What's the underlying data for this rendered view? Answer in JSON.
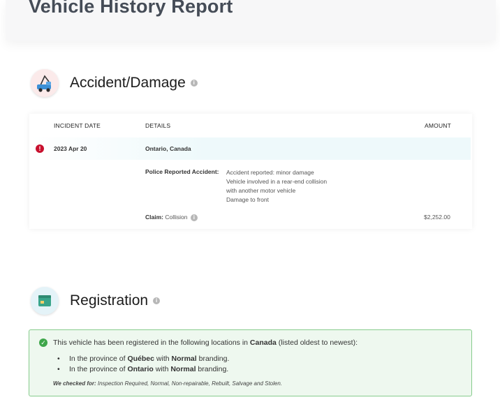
{
  "page": {
    "title": "Vehicle History Report"
  },
  "accident": {
    "title": "Accident/Damage",
    "columns": {
      "date": "INCIDENT DATE",
      "details": "DETAILS",
      "amount": "AMOUNT"
    },
    "record": {
      "date": "2023 Apr 20",
      "location": "Ontario, Canada",
      "police_label": "Police Reported Accident:",
      "police_lines": [
        "Accident reported: minor damage",
        "Vehicle involved in a rear-end collision",
        "with another motor vehicle",
        "Damage to front"
      ],
      "claim_label": "Claim:",
      "claim_value": "Collision",
      "amount": "$2,252.00"
    }
  },
  "registration": {
    "title": "Registration",
    "intro_pre": "This vehicle has been registered in the following locations in ",
    "intro_country": "Canada",
    "intro_post": " (listed oldest to newest):",
    "items": [
      {
        "pre": "In the province of ",
        "province": "Québec",
        "mid": " with ",
        "branding": "Normal",
        "post": " branding."
      },
      {
        "pre": "In the province of ",
        "province": "Ontario",
        "mid": " with ",
        "branding": "Normal",
        "post": " branding."
      }
    ],
    "checked_label": "We checked for:",
    "checked_text": " Inspection Required, Normal, Non-repairable, Rebuilt, Salvage and Stolen."
  },
  "colors": {
    "alert": "#c8102e",
    "success": "#3ea64a",
    "success_bg": "#eef8ef"
  }
}
